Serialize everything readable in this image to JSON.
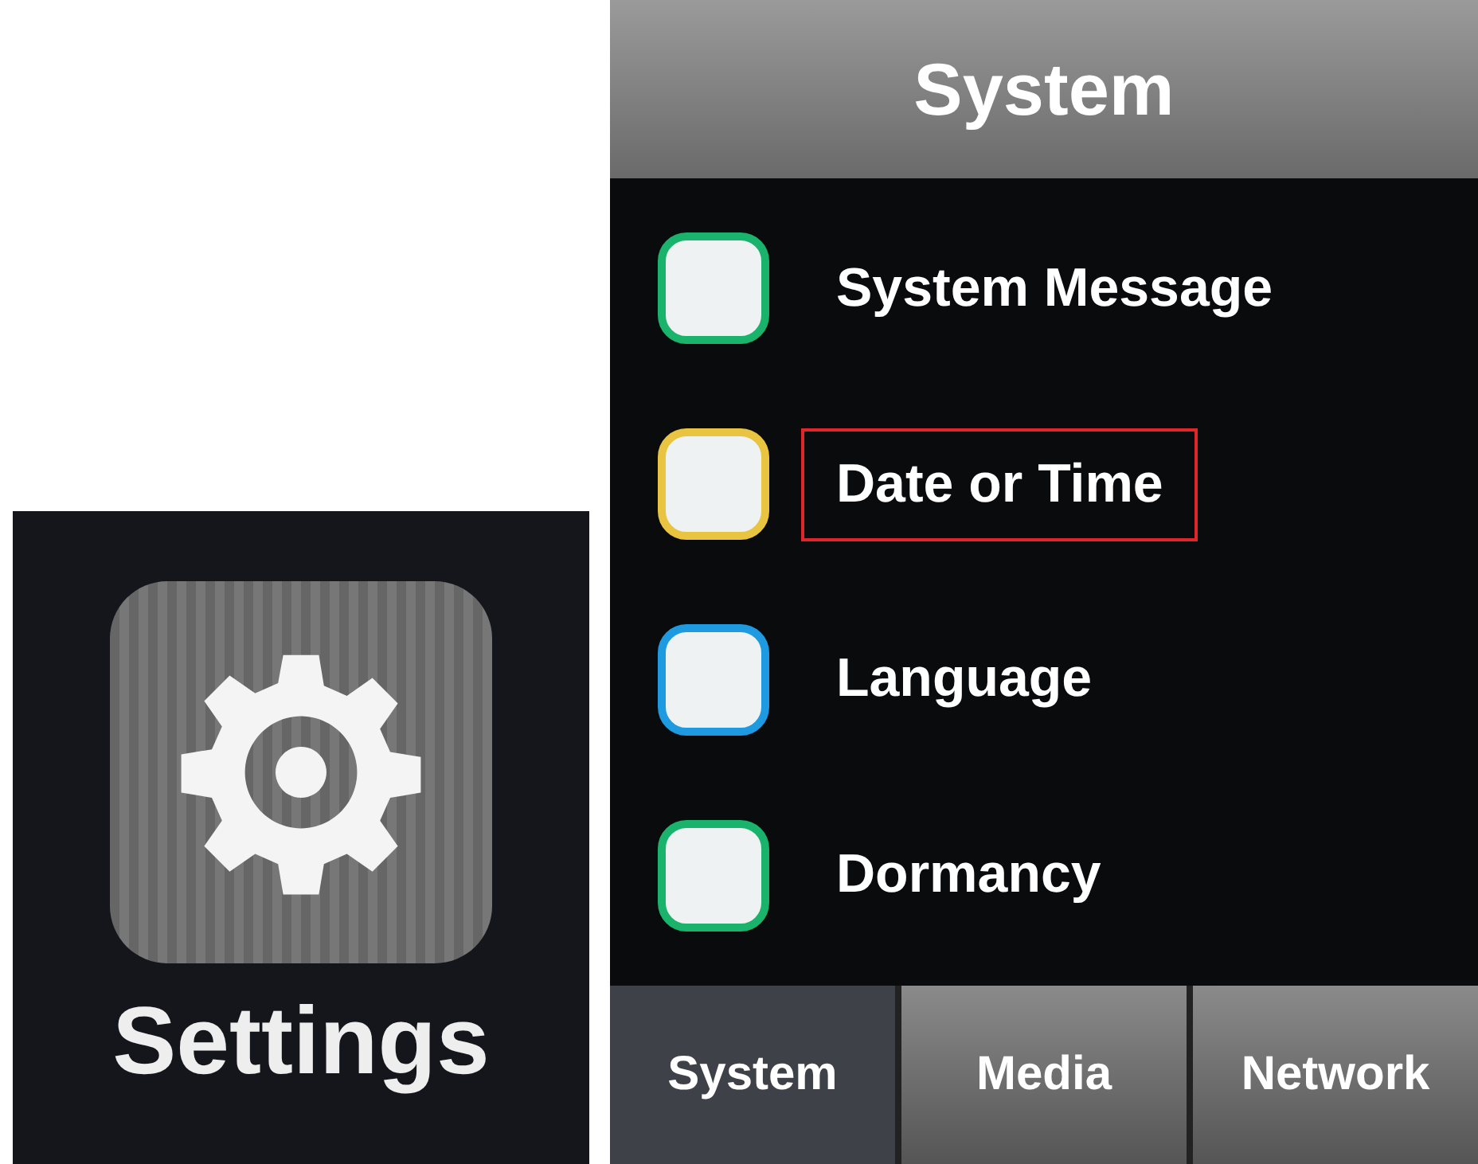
{
  "settings_tile": {
    "label": "Settings"
  },
  "system_screen": {
    "title": "System",
    "items": [
      {
        "label": "System Message",
        "color": "#19b36b",
        "highlighted": false
      },
      {
        "label": "Date or Time",
        "color": "#e8c440",
        "highlighted": true
      },
      {
        "label": "Language",
        "color": "#1e9be0",
        "highlighted": false
      },
      {
        "label": "Dormancy",
        "color": "#19b36b",
        "highlighted": false
      }
    ],
    "tabs": [
      {
        "label": "System",
        "selected": true
      },
      {
        "label": "Media",
        "selected": false
      },
      {
        "label": "Network",
        "selected": false
      }
    ]
  }
}
